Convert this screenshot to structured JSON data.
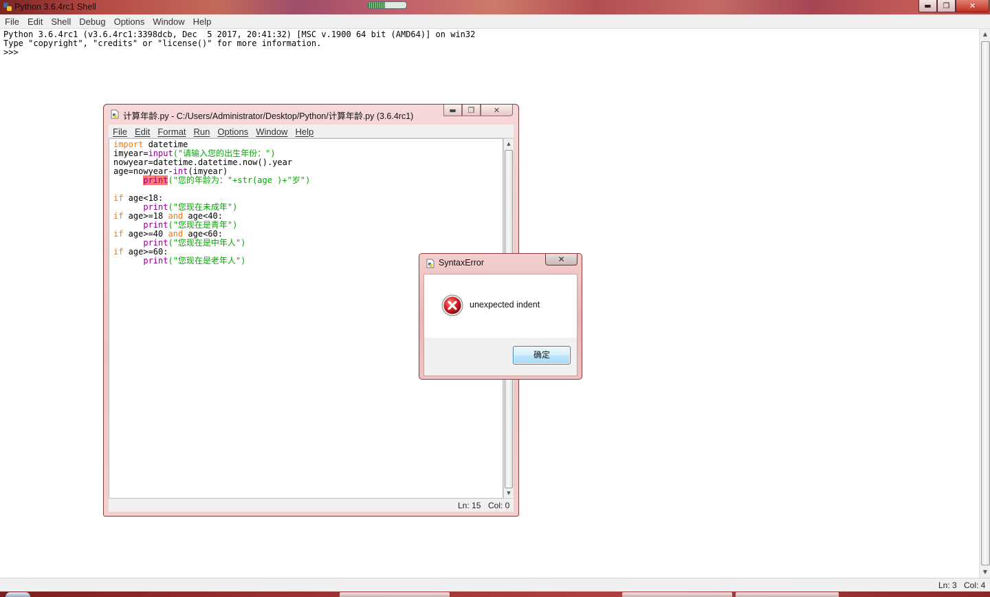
{
  "shell": {
    "title": "Python 3.6.4rc1 Shell",
    "window_controls": {
      "minimize": "▬",
      "maximize": "❐",
      "close": "✕"
    },
    "menu": [
      "File",
      "Edit",
      "Shell",
      "Debug",
      "Options",
      "Window",
      "Help"
    ],
    "output_lines": [
      "Python 3.6.4rc1 (v3.6.4rc1:3398dcb, Dec  5 2017, 20:41:32) [MSC v.1900 64 bit (AMD64)] on win32",
      "Type \"copyright\", \"credits\" or \"license()\" for more information.",
      ">>> "
    ],
    "status": {
      "line": "Ln: 3",
      "col": "Col: 4"
    }
  },
  "editor": {
    "title": "计算年龄.py - C:/Users/Administrator/Desktop/Python/计算年龄.py (3.6.4rc1)",
    "window_controls": {
      "minimize": "▬",
      "maximize": "❐",
      "close": "✕"
    },
    "menu": [
      "File",
      "Edit",
      "Format",
      "Run",
      "Options",
      "Window",
      "Help"
    ],
    "code": {
      "l1_kw": "import",
      "l1_rest": " datetime",
      "l2_a": "imyear=",
      "l2_fn": "input",
      "l2_str": "(\"请输入您的出生年份：\")",
      "l3": "nowyear=datetime.datetime.now().year",
      "l4_a": "age=nowyear-",
      "l4_fn": "int",
      "l4_b": "(imyear)",
      "l5_indent": "      ",
      "l5_fn": "print",
      "l5_str": "(\"您的年龄为：\"+str(age )+\"岁\")",
      "if_kw": "if",
      "and_kw": "and",
      "print_fn": "print",
      "l7_cond": " age<18:",
      "l8_str": "(\"您现在未成年\")",
      "l9_cond1": " age>=18 ",
      "l9_cond2": " age<40:",
      "l10_str": "(\"您现在是青年\")",
      "l11_cond1": " age>=40 ",
      "l11_cond2": " age<60:",
      "l12_str": "(\"您现在是中年人\")",
      "l13_cond": " age>=60:",
      "l14_str": "(\"您现在是老年人\")",
      "indent": "      "
    },
    "status": {
      "line": "Ln: 15",
      "col": "Col: 0"
    }
  },
  "dialog": {
    "title": "SyntaxError",
    "close": "✕",
    "message": "unexpected indent",
    "ok_label": "确定",
    "icon": "error-icon"
  },
  "colors": {
    "keyword": "#ff7700",
    "builtin": "#900090",
    "string": "#00aa00",
    "error_highlight": "#ff7777"
  },
  "progress": {
    "shell_busy_fraction": 0.45
  }
}
